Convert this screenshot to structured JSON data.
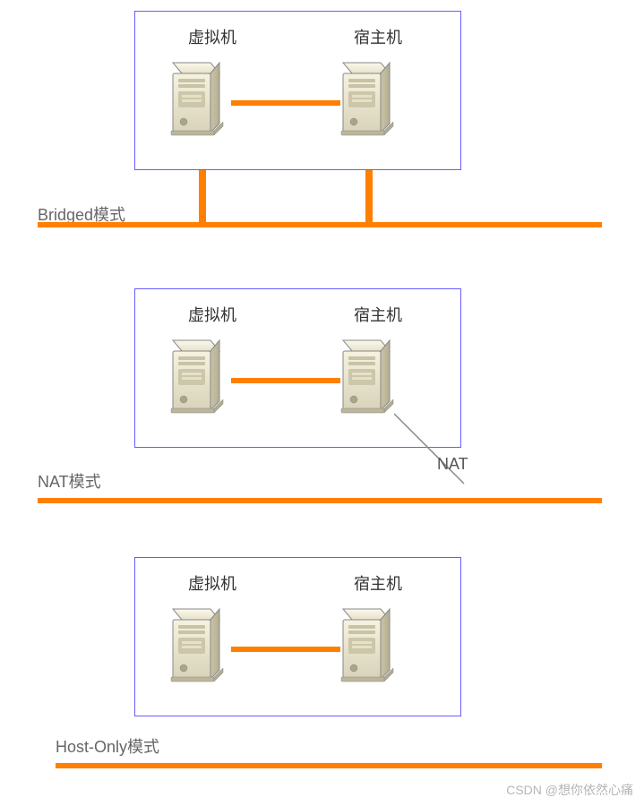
{
  "diagram": {
    "watermark": "CSDN @想你依然心痛",
    "modes": {
      "bridged": {
        "title": "Bridged模式",
        "vm_label": "虚拟机",
        "host_label": "宿主机"
      },
      "nat": {
        "title": "NAT模式",
        "vm_label": "虚拟机",
        "host_label": "宿主机",
        "nat_label": "NAT"
      },
      "hostonly": {
        "title": "Host-Only模式",
        "vm_label": "虚拟机",
        "host_label": "宿主机"
      }
    },
    "icon": {
      "server": "server-tower-icon"
    },
    "colors": {
      "accent": "#ff7f00",
      "box_border": "#6b5cff"
    }
  }
}
